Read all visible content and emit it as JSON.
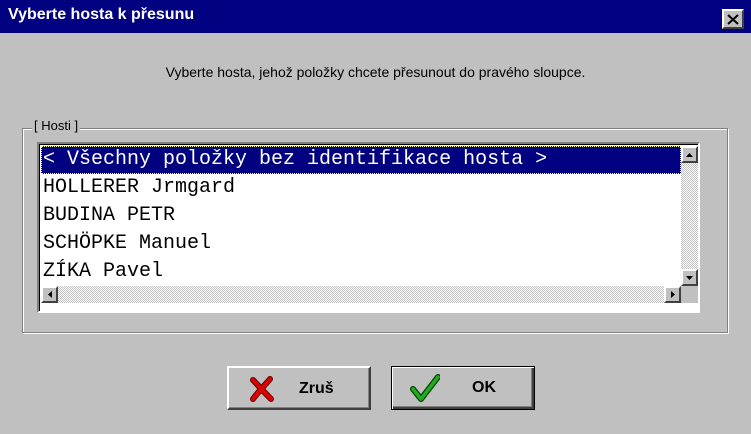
{
  "window": {
    "title": "Vyberte hosta k přesunu"
  },
  "instruction": "Vyberte hosta, jehož položky chcete přesunout do pravého sloupce.",
  "group": {
    "label": "[ Hosti ]",
    "items": [
      {
        "label": "< Všechny položky bez identifikace hosta >",
        "selected": true
      },
      {
        "label": "HOLLERER Jrmgard",
        "selected": false
      },
      {
        "label": "BUDINA PETR",
        "selected": false
      },
      {
        "label": "SCHÖPKE Manuel",
        "selected": false
      },
      {
        "label": "ZÍKA Pavel",
        "selected": false
      }
    ]
  },
  "buttons": {
    "cancel_label": "Zruš",
    "ok_label": "OK"
  },
  "icons": {
    "close": "close-icon",
    "cancel": "red-x-icon",
    "ok": "green-checkmark-icon"
  },
  "colors": {
    "titlebar": "#000080",
    "selection": "#000080",
    "cancel_icon": "#cc0000",
    "ok_icon": "#009900"
  }
}
